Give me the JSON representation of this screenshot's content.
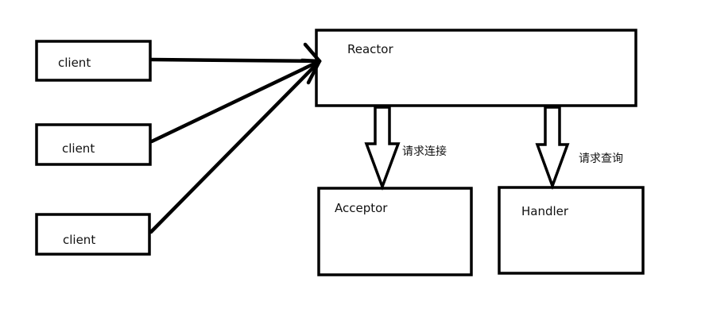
{
  "diagram": {
    "nodes": {
      "client_1": {
        "label": "client"
      },
      "client_2": {
        "label": "client"
      },
      "client_3": {
        "label": "client"
      },
      "reactor": {
        "label": "Reactor"
      },
      "acceptor": {
        "label": "Acceptor"
      },
      "handler": {
        "label": "Handler"
      }
    },
    "edges": [
      {
        "from": "client_1",
        "to": "reactor",
        "style": "line-arrow"
      },
      {
        "from": "client_2",
        "to": "reactor",
        "style": "line-arrow"
      },
      {
        "from": "client_3",
        "to": "reactor",
        "style": "line-arrow"
      },
      {
        "from": "reactor",
        "to": "acceptor",
        "style": "hollow-block-arrow",
        "label": "请求连接"
      },
      {
        "from": "reactor",
        "to": "handler",
        "style": "hollow-block-arrow",
        "label": "请求查询"
      }
    ],
    "colors": {
      "stroke": "#000000",
      "background": "#ffffff"
    }
  }
}
